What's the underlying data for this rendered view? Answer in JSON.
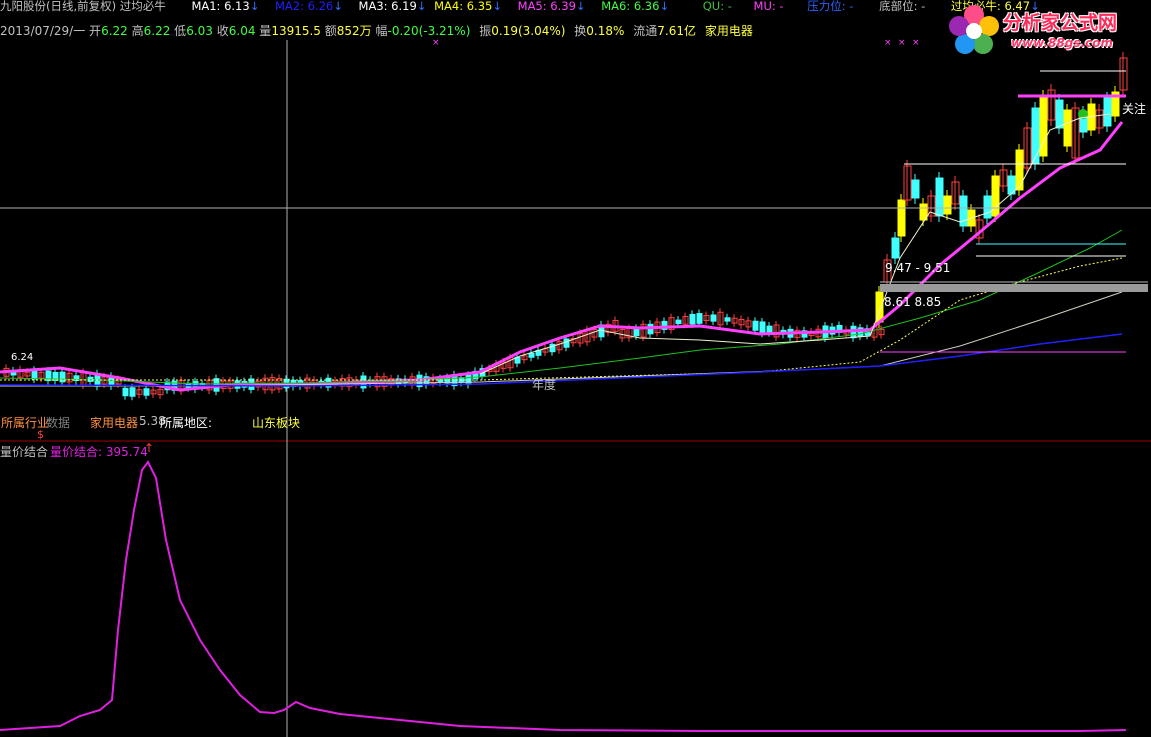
{
  "header": {
    "stock_title": "九阳股份(日线,前复权) 过均必牛",
    "ma": [
      {
        "label": "MA1: 6.13",
        "color": "#ffffff"
      },
      {
        "label": "MA2: 6.26",
        "color": "#2020ff"
      },
      {
        "label": "MA3: 6.19",
        "color": "#ffffff"
      },
      {
        "label": "MA4: 6.35",
        "color": "#ffff00"
      },
      {
        "label": "MA5: 6.39",
        "color": "#ff40ff"
      },
      {
        "label": "MA6: 6.36",
        "color": "#40ff40"
      }
    ],
    "qu": "QU: -",
    "mu": "MU: -",
    "pressure": "压力位: -",
    "bottom": "底部位: -",
    "guojun": "过均必牛: 6.47"
  },
  "info": {
    "date": "2013/07/29/一",
    "open_label": "开",
    "open": "6.22",
    "high_label": "高",
    "high": "6.22",
    "low_label": "低",
    "low": "6.03",
    "close_label": "收",
    "close": "6.04",
    "vol_label": "量",
    "vol": "13915.5",
    "amount_label": "额",
    "amount": "852万",
    "change_label": "幅",
    "change": "-0.20(-3.21%)",
    "amp_label": "振",
    "amp": "0.19(3.04%)",
    "turnover_label": "换",
    "turnover": "0.18%",
    "float_label": "流通",
    "float": "7.61亿",
    "industry": "家用电器"
  },
  "main_chart": {
    "annotations": {
      "range1": "9.47 - 9.51",
      "range2": "8.61   8.85",
      "tag": "关注",
      "early_peak": "6.24",
      "middle_label": "年度"
    }
  },
  "footer": {
    "industry_label": "所属行业",
    "data_label": "数据",
    "industry_value": "家用电器",
    "industry_pe": "5.38",
    "region_label": "所属地区:",
    "region_value": "山东板块",
    "marker": "$"
  },
  "indicator": {
    "name": "量价结合",
    "value_label": "量价结合: 395.74",
    "arrow": "↑"
  },
  "logo": {
    "title": "分析家公式网",
    "url": "www.88gs.com"
  }
}
